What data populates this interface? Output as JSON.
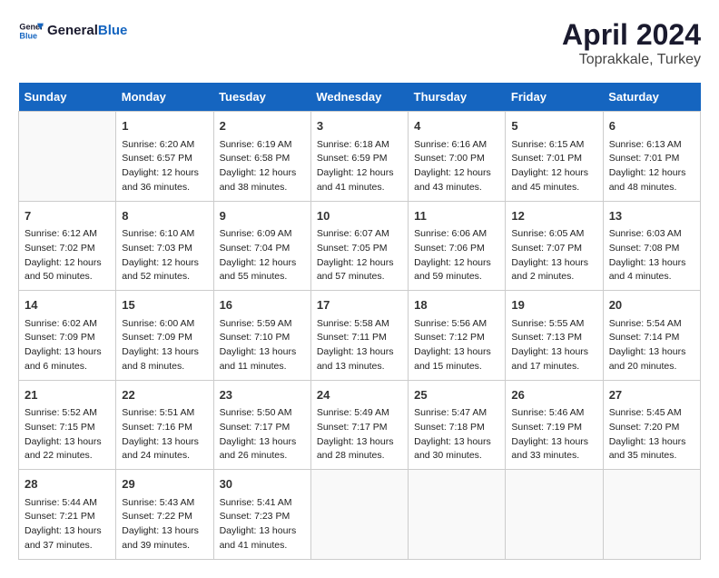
{
  "header": {
    "logo_general": "General",
    "logo_blue": "Blue",
    "title": "April 2024",
    "subtitle": "Toprakkale, Turkey"
  },
  "days_of_week": [
    "Sunday",
    "Monday",
    "Tuesday",
    "Wednesday",
    "Thursday",
    "Friday",
    "Saturday"
  ],
  "weeks": [
    [
      {
        "day": "",
        "info": ""
      },
      {
        "day": "1",
        "info": "Sunrise: 6:20 AM\nSunset: 6:57 PM\nDaylight: 12 hours\nand 36 minutes."
      },
      {
        "day": "2",
        "info": "Sunrise: 6:19 AM\nSunset: 6:58 PM\nDaylight: 12 hours\nand 38 minutes."
      },
      {
        "day": "3",
        "info": "Sunrise: 6:18 AM\nSunset: 6:59 PM\nDaylight: 12 hours\nand 41 minutes."
      },
      {
        "day": "4",
        "info": "Sunrise: 6:16 AM\nSunset: 7:00 PM\nDaylight: 12 hours\nand 43 minutes."
      },
      {
        "day": "5",
        "info": "Sunrise: 6:15 AM\nSunset: 7:01 PM\nDaylight: 12 hours\nand 45 minutes."
      },
      {
        "day": "6",
        "info": "Sunrise: 6:13 AM\nSunset: 7:01 PM\nDaylight: 12 hours\nand 48 minutes."
      }
    ],
    [
      {
        "day": "7",
        "info": "Sunrise: 6:12 AM\nSunset: 7:02 PM\nDaylight: 12 hours\nand 50 minutes."
      },
      {
        "day": "8",
        "info": "Sunrise: 6:10 AM\nSunset: 7:03 PM\nDaylight: 12 hours\nand 52 minutes."
      },
      {
        "day": "9",
        "info": "Sunrise: 6:09 AM\nSunset: 7:04 PM\nDaylight: 12 hours\nand 55 minutes."
      },
      {
        "day": "10",
        "info": "Sunrise: 6:07 AM\nSunset: 7:05 PM\nDaylight: 12 hours\nand 57 minutes."
      },
      {
        "day": "11",
        "info": "Sunrise: 6:06 AM\nSunset: 7:06 PM\nDaylight: 12 hours\nand 59 minutes."
      },
      {
        "day": "12",
        "info": "Sunrise: 6:05 AM\nSunset: 7:07 PM\nDaylight: 13 hours\nand 2 minutes."
      },
      {
        "day": "13",
        "info": "Sunrise: 6:03 AM\nSunset: 7:08 PM\nDaylight: 13 hours\nand 4 minutes."
      }
    ],
    [
      {
        "day": "14",
        "info": "Sunrise: 6:02 AM\nSunset: 7:09 PM\nDaylight: 13 hours\nand 6 minutes."
      },
      {
        "day": "15",
        "info": "Sunrise: 6:00 AM\nSunset: 7:09 PM\nDaylight: 13 hours\nand 8 minutes."
      },
      {
        "day": "16",
        "info": "Sunrise: 5:59 AM\nSunset: 7:10 PM\nDaylight: 13 hours\nand 11 minutes."
      },
      {
        "day": "17",
        "info": "Sunrise: 5:58 AM\nSunset: 7:11 PM\nDaylight: 13 hours\nand 13 minutes."
      },
      {
        "day": "18",
        "info": "Sunrise: 5:56 AM\nSunset: 7:12 PM\nDaylight: 13 hours\nand 15 minutes."
      },
      {
        "day": "19",
        "info": "Sunrise: 5:55 AM\nSunset: 7:13 PM\nDaylight: 13 hours\nand 17 minutes."
      },
      {
        "day": "20",
        "info": "Sunrise: 5:54 AM\nSunset: 7:14 PM\nDaylight: 13 hours\nand 20 minutes."
      }
    ],
    [
      {
        "day": "21",
        "info": "Sunrise: 5:52 AM\nSunset: 7:15 PM\nDaylight: 13 hours\nand 22 minutes."
      },
      {
        "day": "22",
        "info": "Sunrise: 5:51 AM\nSunset: 7:16 PM\nDaylight: 13 hours\nand 24 minutes."
      },
      {
        "day": "23",
        "info": "Sunrise: 5:50 AM\nSunset: 7:17 PM\nDaylight: 13 hours\nand 26 minutes."
      },
      {
        "day": "24",
        "info": "Sunrise: 5:49 AM\nSunset: 7:17 PM\nDaylight: 13 hours\nand 28 minutes."
      },
      {
        "day": "25",
        "info": "Sunrise: 5:47 AM\nSunset: 7:18 PM\nDaylight: 13 hours\nand 30 minutes."
      },
      {
        "day": "26",
        "info": "Sunrise: 5:46 AM\nSunset: 7:19 PM\nDaylight: 13 hours\nand 33 minutes."
      },
      {
        "day": "27",
        "info": "Sunrise: 5:45 AM\nSunset: 7:20 PM\nDaylight: 13 hours\nand 35 minutes."
      }
    ],
    [
      {
        "day": "28",
        "info": "Sunrise: 5:44 AM\nSunset: 7:21 PM\nDaylight: 13 hours\nand 37 minutes."
      },
      {
        "day": "29",
        "info": "Sunrise: 5:43 AM\nSunset: 7:22 PM\nDaylight: 13 hours\nand 39 minutes."
      },
      {
        "day": "30",
        "info": "Sunrise: 5:41 AM\nSunset: 7:23 PM\nDaylight: 13 hours\nand 41 minutes."
      },
      {
        "day": "",
        "info": ""
      },
      {
        "day": "",
        "info": ""
      },
      {
        "day": "",
        "info": ""
      },
      {
        "day": "",
        "info": ""
      }
    ]
  ]
}
